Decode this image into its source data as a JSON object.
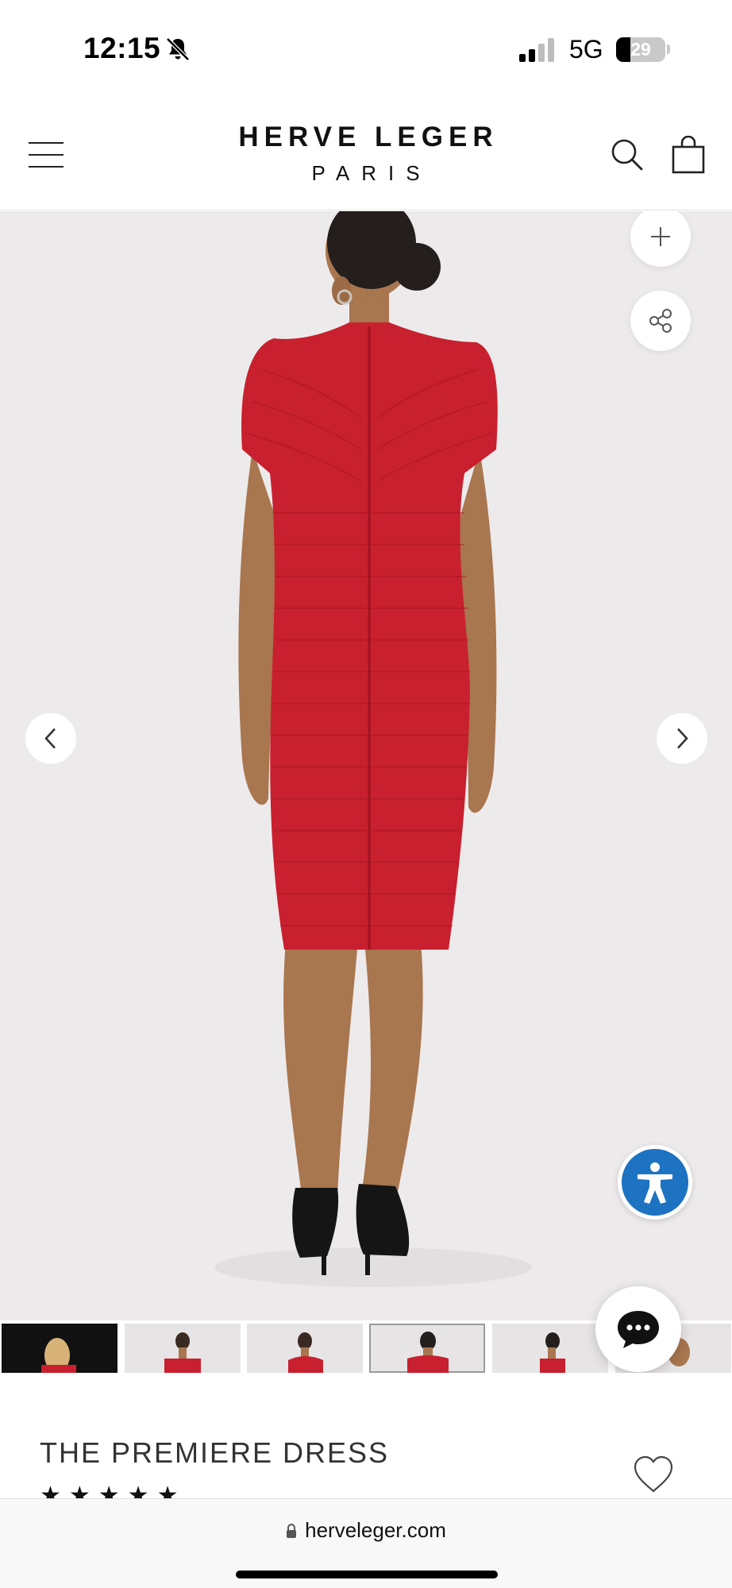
{
  "status_bar": {
    "time": "12:15",
    "network": "5G",
    "battery": "29",
    "battery_level": 0.29
  },
  "header": {
    "brand": "HERVE LEGER",
    "brand_sub": "PARIS"
  },
  "gallery": {
    "background": "#edeaeb",
    "dress_color": "#c8202e",
    "thumbnails": [
      {
        "alt": "model-front-black-background",
        "active": false
      },
      {
        "alt": "dress-front",
        "active": false
      },
      {
        "alt": "dress-three-quarter",
        "active": false
      },
      {
        "alt": "dress-back",
        "active": true
      },
      {
        "alt": "dress-side",
        "active": false
      },
      {
        "alt": "dress-detail",
        "active": false
      }
    ]
  },
  "product": {
    "title": "THE PREMIERE DRESS",
    "rating_stars": "★★★★★"
  },
  "browser": {
    "url": "herveleger.com"
  },
  "colors": {
    "accessibility_blue": "#1d72c1",
    "text_dark": "#1f1f1f"
  }
}
